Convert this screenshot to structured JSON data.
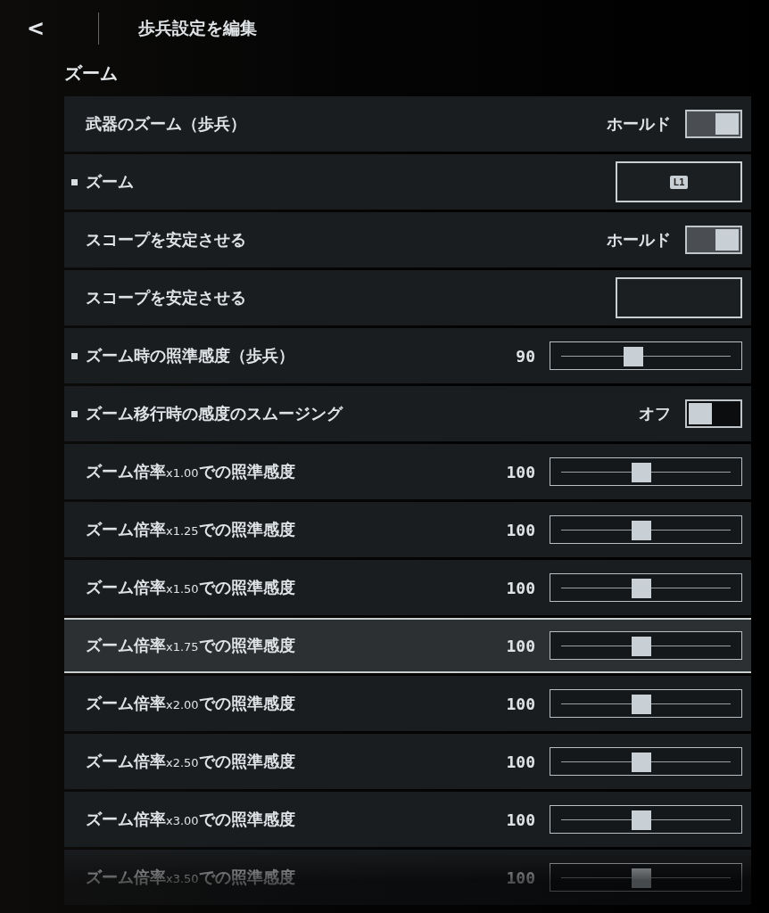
{
  "header": {
    "back": "<",
    "title": "歩兵設定を編集"
  },
  "section": "ズーム",
  "rows": [
    {
      "kind": "toggle",
      "label": "武器のズーム（歩兵）",
      "marked": false,
      "selected": false,
      "value": "ホールド",
      "on": true
    },
    {
      "kind": "keybind",
      "label": "ズーム",
      "marked": true,
      "selected": false,
      "key": "L1"
    },
    {
      "kind": "toggle",
      "label": "スコープを安定させる",
      "marked": false,
      "selected": false,
      "value": "ホールド",
      "on": true
    },
    {
      "kind": "keybind",
      "label": "スコープを安定させる",
      "marked": false,
      "selected": false
    },
    {
      "kind": "slider",
      "label": "ズーム時の照準感度（歩兵）",
      "marked": true,
      "selected": false,
      "value": "90",
      "level": 0.42
    },
    {
      "kind": "toggle",
      "label": "ズーム移行時の感度のスムージング",
      "marked": true,
      "selected": false,
      "value": "オフ",
      "on": false
    },
    {
      "kind": "slider",
      "label": "ズーム倍率",
      "factor": "x1.00",
      "suffix": "での照準感度",
      "marked": false,
      "selected": false,
      "value": "100",
      "level": 0.47
    },
    {
      "kind": "slider",
      "label": "ズーム倍率",
      "factor": "x1.25",
      "suffix": "での照準感度",
      "marked": false,
      "selected": false,
      "value": "100",
      "level": 0.47
    },
    {
      "kind": "slider",
      "label": "ズーム倍率",
      "factor": "x1.50",
      "suffix": "での照準感度",
      "marked": false,
      "selected": false,
      "value": "100",
      "level": 0.47
    },
    {
      "kind": "slider",
      "label": "ズーム倍率",
      "factor": "x1.75",
      "suffix": "での照準感度",
      "marked": false,
      "selected": true,
      "value": "100",
      "level": 0.47
    },
    {
      "kind": "slider",
      "label": "ズーム倍率",
      "factor": "x2.00",
      "suffix": "での照準感度",
      "marked": false,
      "selected": false,
      "value": "100",
      "level": 0.47
    },
    {
      "kind": "slider",
      "label": "ズーム倍率",
      "factor": "x2.50",
      "suffix": "での照準感度",
      "marked": false,
      "selected": false,
      "value": "100",
      "level": 0.47
    },
    {
      "kind": "slider",
      "label": "ズーム倍率",
      "factor": "x3.00",
      "suffix": "での照準感度",
      "marked": false,
      "selected": false,
      "value": "100",
      "level": 0.47
    },
    {
      "kind": "slider",
      "label": "ズーム倍率",
      "factor": "x3.50",
      "suffix": "での照準感度",
      "marked": false,
      "selected": false,
      "value": "100",
      "level": 0.47
    }
  ]
}
